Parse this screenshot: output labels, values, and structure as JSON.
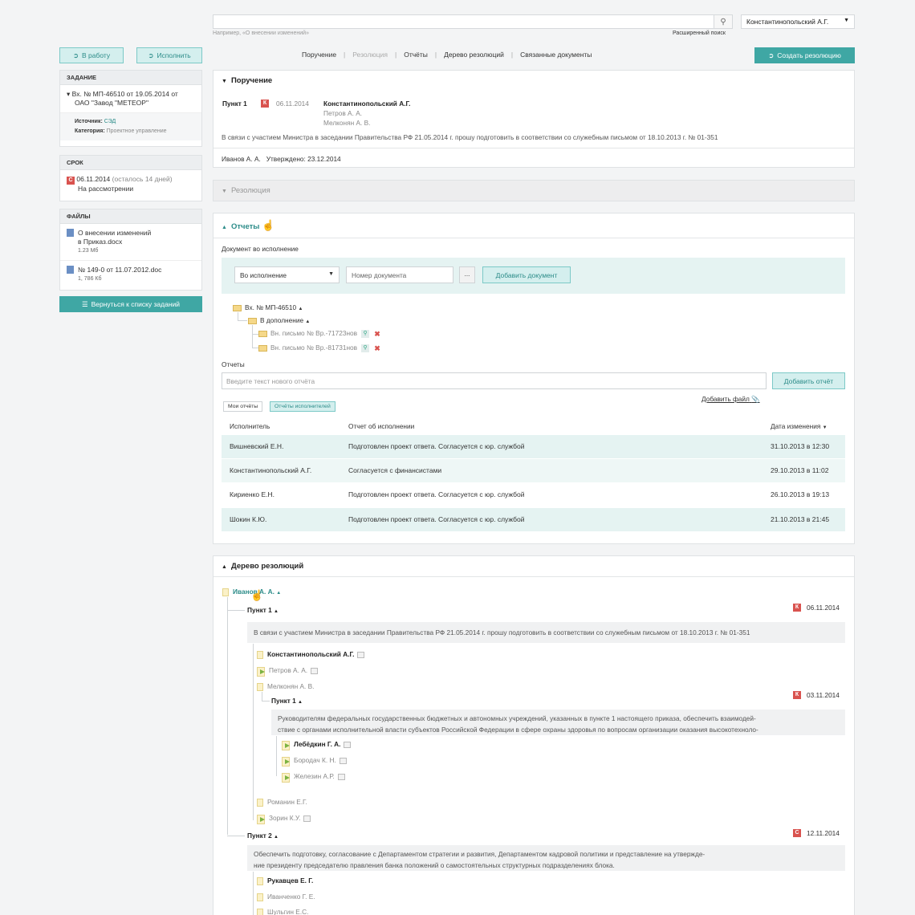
{
  "search": {
    "placeholder": "",
    "hint": "Например, «О внесении изменений»",
    "advanced_label": "Расширенный поиск"
  },
  "user": {
    "name": "Константинопольский А.Г."
  },
  "toolbar": {
    "to_work_label": "В работу",
    "execute_label": "Исполнить",
    "create_resolution_label": "Создать резолюцию"
  },
  "nav": {
    "tabs": [
      "Поручение",
      "Резолюция",
      "Отчёты",
      "Дерево резолюций",
      "Связанные документы"
    ],
    "active_index": 1
  },
  "sidebar": {
    "task": {
      "header": "ЗАДАНИЕ",
      "title_line1": "Вх. № МП-46510 от 19.05.2014 от",
      "title_line2": "ОАО \"Завод \"МЕТЕОР\"",
      "source_label": "Источник:",
      "source_value": "СЭД",
      "category_label": "Категория:",
      "category_value": "Проектное управление"
    },
    "deadline": {
      "header": "СРОК",
      "date": "06.11.2014",
      "remaining": "(осталось 14 дней)",
      "status": "На рассмотрении",
      "badge": "С"
    },
    "files": {
      "header": "ФАЙЛЫ",
      "items": [
        {
          "name_line1": "О внесении изменений",
          "name_line2": "в Приказ.docx",
          "size": "1.23 Мб"
        },
        {
          "name_line1": "№ 149-0 от 11.07.2012.doc",
          "name_line2": "",
          "size": "1, 786 Кб"
        }
      ]
    },
    "back_label": "Вернуться к списку заданий"
  },
  "assignment": {
    "header": "Поручение",
    "item_label": "Пункт 1",
    "badge": "К",
    "date": "06.11.2014",
    "executors": [
      "Константинопольский А.Г.",
      "Петров А. А.",
      "Мелконян А. В."
    ],
    "text": "В связи с участием Министра в заседании Правительства РФ 21.05.2014 г. прошу подготовить в соответствии со служебным письмом от 18.10.2013 г. № 01-351",
    "author": "Иванов А. А.",
    "approved": "Утверждено: 23.12.2014"
  },
  "resolution": {
    "header": "Резолюция"
  },
  "reports": {
    "header": "Отчеты",
    "doc_label": "Документ во исполнение",
    "type_select": "Во исполнение",
    "doc_number_placeholder": "Номер документа",
    "dots_label": "...",
    "add_doc_label": "Добавить документ",
    "tree": {
      "root": "Вх. № МП-46510",
      "child": "В дополнение",
      "letters": [
        "Вн. письмо № Вр.-71723нов",
        "Вн. письмо № Вр.-81731нов"
      ]
    },
    "reports_label": "Отчеты",
    "report_placeholder": "Введите текст нового отчёта",
    "add_report_label": "Добавить отчёт",
    "add_file_label": "Добавить файл",
    "tabs": [
      "Мои отчёты",
      "Отчёты исполнителей"
    ],
    "columns": [
      "Исполнитель",
      "Отчет об исполнении",
      "Дата изменения"
    ],
    "rows": [
      {
        "executor": "Вишневский Е.Н.",
        "report": "Подготовлен проект ответа. Согласуется с юр. службой",
        "date": "31.10.2013 в 12:30"
      },
      {
        "executor": "Константинопольский А.Г.",
        "report": "Согласуется с финансистами",
        "date": "29.10.2013 в 11:02"
      },
      {
        "executor": "Кириенко Е.Н.",
        "report": "Подготовлен проект ответа. Согласуется с юр. службой",
        "date": "26.10.2013 в 19:13"
      },
      {
        "executor": "Шокин К.Ю.",
        "report": "Подготовлен проект ответа. Согласуется с юр. службой",
        "date": "21.10.2013 в 21:45"
      }
    ]
  },
  "resolution_tree": {
    "header": "Дерево резолюций",
    "root": "Иванов А. А.",
    "point1": {
      "label": "Пункт 1",
      "badge": "К",
      "date": "06.11.2014",
      "text": "В связи с участием Министра в заседании Правительства РФ 21.05.2014 г. прошу подготовить в соответствии со служебным письмом от 18.10.2013 г. № 01-351",
      "people": [
        "Константинопольский А.Г.",
        "Петров А. А.",
        "Мелконян А. В."
      ]
    },
    "sub_point1": {
      "label": "Пункт 1",
      "badge": "К",
      "date": "03.11.2014",
      "text_line1": "Руководителям федеральных государственных бюджетных и автономных учреждений, указанных в пункте 1 настоящего приказа, обеспечить взаимодей-",
      "text_line2": "ствие с органами исполнительной власти субъектов Российской Федерации в сфере охраны здоровья по вопросам организации оказания высокотехноло-",
      "people": [
        "Лебёдкин Г. А.",
        "Бородач К. Н.",
        "Железин А.Р."
      ]
    },
    "after_people": [
      "Романин Е.Г.",
      "Зорин К.У."
    ],
    "point2": {
      "label": "Пункт 2",
      "badge": "С",
      "date": "12.11.2014",
      "text_line1": "Обеспечить подготовку, согласование с Департаментом стратегии и развития, Департаментом кадровой политики и представление на утвержде-",
      "text_line2": "ние президенту председателю правления банка положений о самостоятельных структурных подразделениях блока.",
      "people": [
        "Рукавцев Е. Г.",
        "Иванченко Г. Е.",
        "Шульгин Е.С."
      ]
    }
  },
  "colors": {
    "accent": "#3fa7a4",
    "accent_light": "#d4efee",
    "danger": "#d9534f",
    "row_alt": "#e5f3f2"
  }
}
